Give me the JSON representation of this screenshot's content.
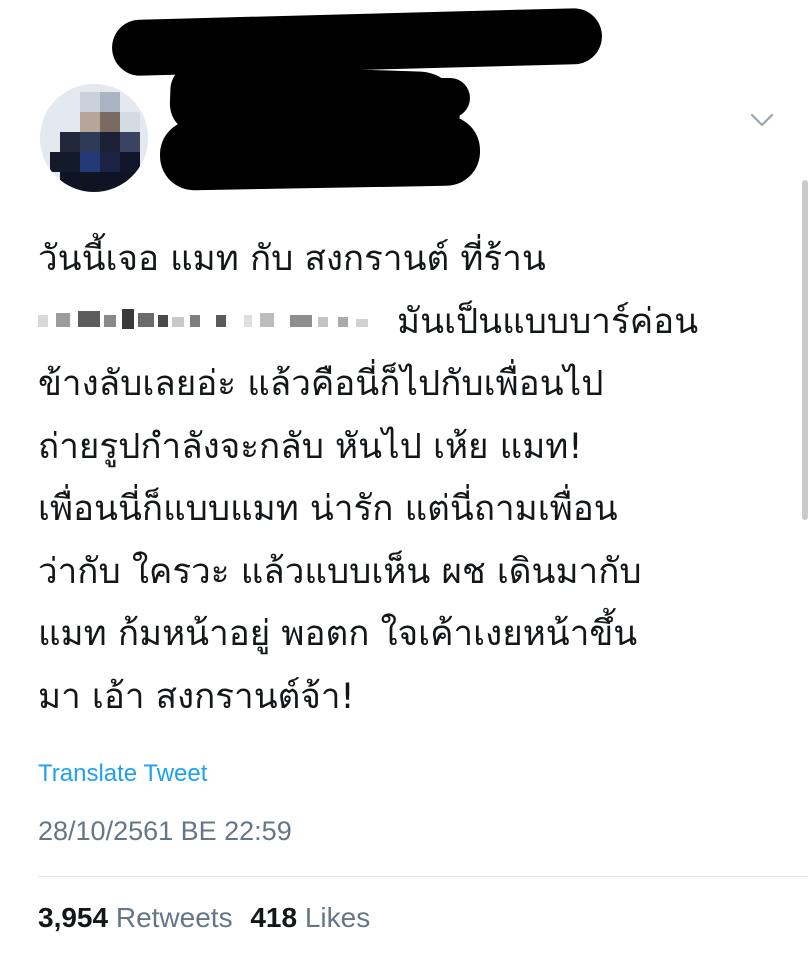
{
  "tweet": {
    "text_lines": {
      "l1": "วันนี้เจอ แมท กับ สงกรานต์ ที่ร้าน",
      "l2": "มันเป็นแบบบาร์ค่อน",
      "l3": "ข้างลับเลยอ่ะ แล้วคือนี่ก็ไปกับเพื่อนไป",
      "l4": "ถ่ายรูปกำลังจะกลับ หันไป เห้ย แมท!",
      "l5": "เพื่อนนี่ก็แบบแมท น่ารัก แต่นี่ถามเพื่อน",
      "l6": "ว่ากับ ใครวะ แล้วแบบเห็น ผช เดินมากับ",
      "l7": "แมท ก้มหน้าอยู่ พอตก ใจเค้าเงยหน้าขึ้น",
      "l8": "มา เอ้า สงกรานต์จ้า!"
    },
    "translate_label": "Translate Tweet",
    "timestamp": "28/10/2561 BE 22:59",
    "retweets_count": "3,954",
    "retweets_label": "Retweets",
    "likes_count": "418",
    "likes_label": "Likes"
  },
  "colors": {
    "text": "#14171a",
    "link": "#1da1f2",
    "muted": "#657786",
    "divider": "#e1e8ed",
    "redaction": "#000000"
  },
  "icons": {
    "more_options": "chevron-down-icon"
  }
}
